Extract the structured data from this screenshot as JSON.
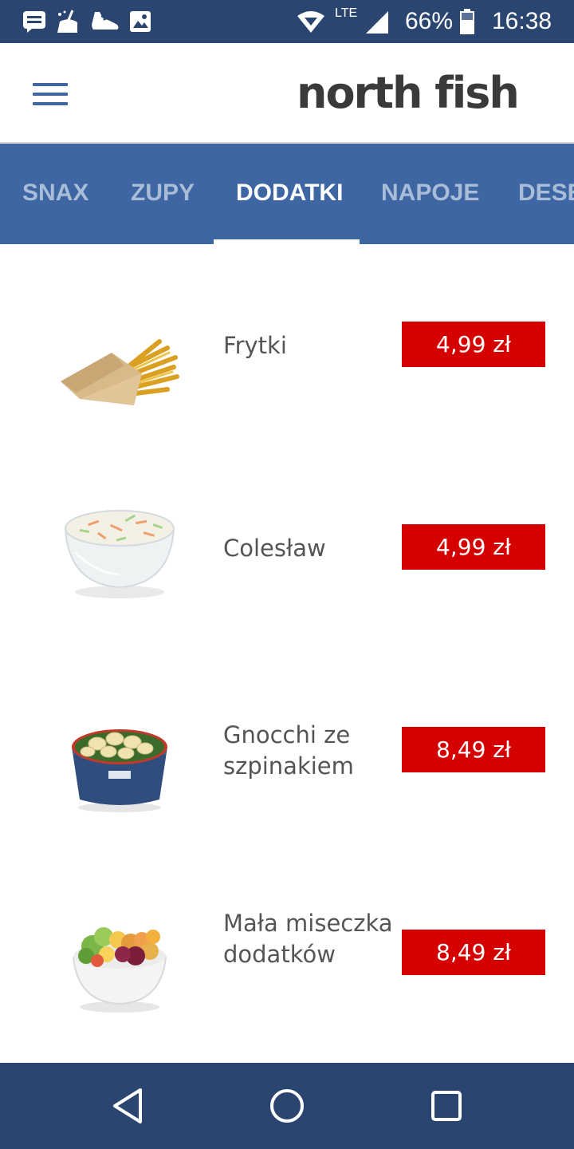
{
  "status_bar": {
    "icons": [
      "message-icon",
      "cleaner-icon",
      "shoe-icon",
      "image-icon",
      "wifi-icon",
      "signal-icon",
      "battery-icon"
    ],
    "network": "LTE",
    "battery": "66%",
    "time": "16:38"
  },
  "header": {
    "menu_icon": "hamburger-menu-icon",
    "brand": "north fish"
  },
  "tabs": [
    {
      "label": "SNAX"
    },
    {
      "label": "ZUPY"
    },
    {
      "label": "DODATKI"
    },
    {
      "label": "NAPOJE"
    },
    {
      "label": "DESE"
    }
  ],
  "active_tab": "DODATKI",
  "items": [
    {
      "name": "Frytki",
      "price": "4,99 zł",
      "image": "fries-image"
    },
    {
      "name": "Colesław",
      "price": "4,99 zł",
      "image": "coleslaw-bowl-image"
    },
    {
      "name": "Gnocchi ze szpinakiem",
      "price": "8,49 zł",
      "image": "gnocchi-bowl-image"
    },
    {
      "name": "Mała miseczka dodatków",
      "price": "8,49 zł",
      "image": "salad-bowl-image"
    }
  ],
  "nav_bar": {
    "icons": [
      "back-icon",
      "home-icon",
      "recents-icon"
    ]
  },
  "colors": {
    "status_bar": "#2a4670",
    "tab_bar": "#3d66a3",
    "price": "#d50000",
    "tab_inactive": "#a9bcd8"
  }
}
